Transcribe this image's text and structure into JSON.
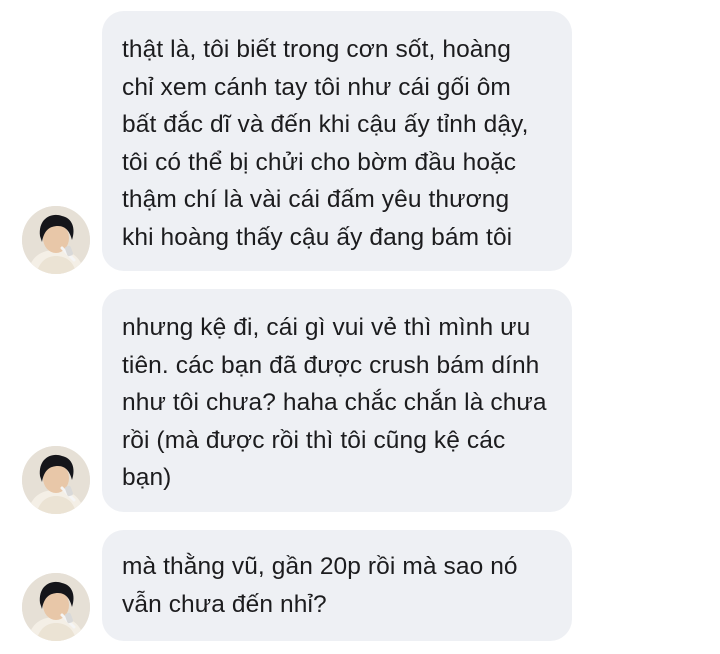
{
  "chat": {
    "messages": [
      {
        "text": "thật là, tôi biết trong cơn sốt, hoàng\nchỉ xem cánh tay tôi như cái gối ôm\nbất đắc dĩ và đến khi cậu ấy tỉnh dậy,\ntôi có thể bị chửi cho bờm đầu hoặc\nthậm chí là vài cái đấm yêu thương\nkhi hoàng thấy cậu ấy đang bám tôi",
        "avatar_icon": "profile-avatar-icon"
      },
      {
        "text": "nhưng kệ đi, cái gì vui vẻ thì mình ưu\ntiên. các bạn đã được crush bám dính\nnhư tôi chưa? haha chắc chắn là chưa\nrồi (mà được rồi thì tôi cũng kệ các\nbạn)",
        "avatar_icon": "profile-avatar-icon"
      },
      {
        "text": "mà thằng vũ, gần 20p rồi mà sao nó\nvẫn chưa đến nhỉ?",
        "avatar_icon": "profile-avatar-icon"
      }
    ]
  },
  "colors": {
    "bubble_background": "#eef0f4",
    "text": "#1c1c1e",
    "page_background": "#ffffff"
  }
}
